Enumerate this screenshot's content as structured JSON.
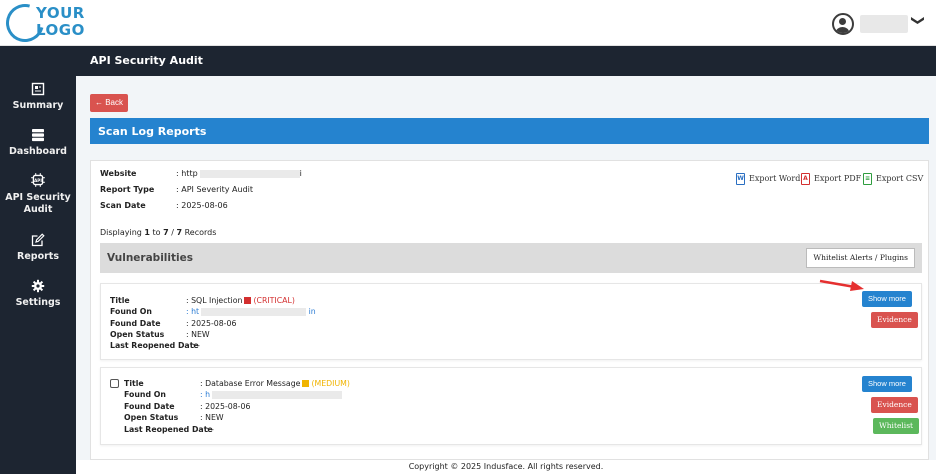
{
  "logo": {
    "line1": "YOUR",
    "line2": "LOGO"
  },
  "user": {
    "chevron": "❯"
  },
  "sidebar": {
    "items": [
      {
        "label": "Summary",
        "icon": "summary-icon"
      },
      {
        "label": "Dashboard",
        "icon": "dashboard-icon"
      },
      {
        "label": "API Security Audit",
        "icon": "api-icon"
      },
      {
        "label": "Reports",
        "icon": "edit-icon"
      },
      {
        "label": "Settings",
        "icon": "gear-icon"
      }
    ]
  },
  "page_title": "API Security Audit",
  "back_label": "← Back",
  "section_title": "Scan Log Reports",
  "report": {
    "website_label": "Website",
    "website_value": ": http",
    "website_tail": "i",
    "report_type_label": "Report Type",
    "report_type_value": ": API Severity Audit",
    "scan_date_label": "Scan Date",
    "scan_date_value": ": 2025-08-06"
  },
  "exports": {
    "word": "Export Word",
    "pdf": "Export PDF",
    "csv": "Export CSV"
  },
  "displaying": {
    "prefix": "Displaying ",
    "from": "1",
    "to_word": " to ",
    "to": "7",
    "sep": " / ",
    "total": "7",
    "suffix": " Records"
  },
  "vulnerabilities_title": "Vulnerabilities",
  "whitelist_alerts_label": "Whitelist Alerts / Plugins",
  "labels": {
    "title": "Title",
    "found_on": "Found On",
    "found_date": "Found Date",
    "open_status": "Open Status",
    "last_reopened": "Last Reopened Date"
  },
  "vulns": [
    {
      "title": ": SQL Injection",
      "severity": "(CRITICAL)",
      "found_on_prefix": ": ht",
      "found_on_suffix": "in",
      "found_date": ": 2025-08-06",
      "open_status": ": NEW",
      "last_reopened": ": -"
    },
    {
      "title": ": Database Error Message",
      "severity": "(MEDIUM)",
      "found_on_prefix": ": h",
      "found_on_suffix": "",
      "found_date": ": 2025-08-06",
      "open_status": ": NEW",
      "last_reopened": ": -"
    }
  ],
  "buttons": {
    "show_more": "Show more",
    "evidence": "Evidence",
    "whitelist": "Whitelist"
  },
  "footer": "Copyright © 2025 Indusface. All rights reserved.",
  "colors": {
    "sidebar": "#1d2531",
    "accent_blue": "#2583cf",
    "danger": "#d9534f",
    "success": "#5cb85c",
    "critical": "#d32f2f",
    "medium": "#f0b400"
  }
}
